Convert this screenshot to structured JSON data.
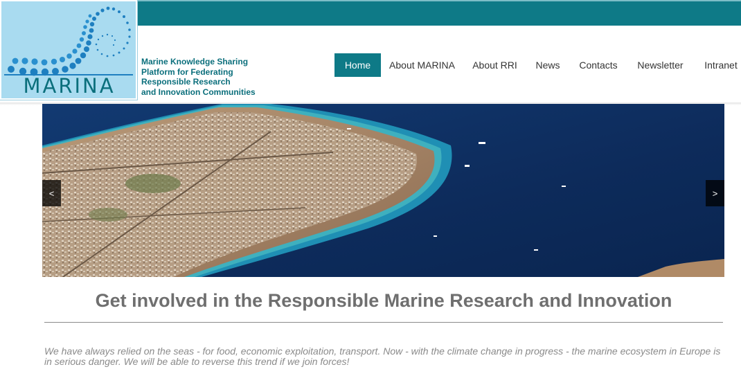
{
  "brand": {
    "logo_text": "MARINA",
    "tagline_lines": [
      "Marine Knowledge Sharing",
      "Platform for Federating",
      "Responsible Research",
      "and Innovation Communities"
    ]
  },
  "nav": {
    "items": [
      {
        "label": "Home",
        "active": true
      },
      {
        "label": "About MARINA",
        "active": false
      },
      {
        "label": "About RRI",
        "active": false
      },
      {
        "label": "News",
        "active": false
      },
      {
        "label": "Contacts",
        "active": false
      },
      {
        "label": "Newsletter",
        "active": false
      },
      {
        "label": "Intranet",
        "active": false
      }
    ]
  },
  "slider": {
    "prev_label": "<",
    "next_label": ">"
  },
  "main": {
    "headline": "Get involved in the Responsible Marine Research and Innovation",
    "intro": "We have always relied on the seas - for food, economic exploitation, transport. Now - with the climate change in progress - the marine ecosystem in Europe is in serious danger. We will be able to reverse this trend if we join forces!"
  },
  "colors": {
    "teal": "#0e7a87",
    "logo_background": "#a9dbf0",
    "headline_gray": "#6f6f6f",
    "sea_deep": "#0e2c5a"
  }
}
